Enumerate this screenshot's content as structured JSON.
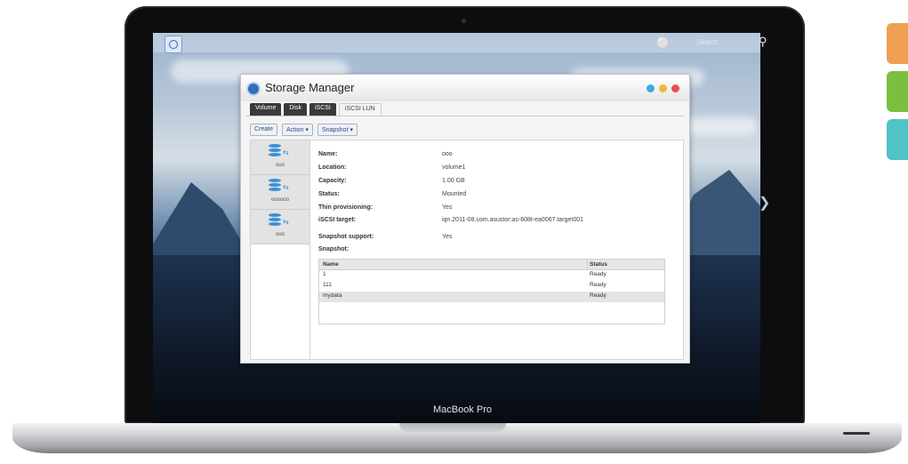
{
  "colors": {
    "accent": "#2f6fb7",
    "tab_orange": "#f0a052",
    "tab_green": "#7bbf3f",
    "tab_teal": "#4fc3c7"
  },
  "laptop": {
    "model_label": "MacBook Pro"
  },
  "desktop": {
    "search_placeholder": "Search",
    "icons": {
      "home": "home-icon",
      "user": "user-icon",
      "search": "search-icon",
      "next": "chevron-right-icon"
    }
  },
  "window": {
    "title": "Storage Manager",
    "controls": [
      "minimize",
      "maximize",
      "close"
    ],
    "tabs": [
      {
        "label": "Volume",
        "active": false
      },
      {
        "label": "Disk",
        "active": false
      },
      {
        "label": "iSCSI",
        "active": false
      },
      {
        "label": "iSCSI LUN",
        "active": true
      }
    ],
    "toolbar": {
      "create": "Create",
      "action": "Action ▾",
      "snapshot": "Snapshot ▾"
    },
    "luns": [
      {
        "label": "ooo"
      },
      {
        "label": "oooooo"
      },
      {
        "label": "ooo"
      }
    ],
    "properties": [
      {
        "key": "Name:",
        "value": "ooo"
      },
      {
        "key": "Location:",
        "value": "volume1"
      },
      {
        "key": "Capacity:",
        "value": "1.00 GB"
      },
      {
        "key": "Status:",
        "value": "Mounted"
      },
      {
        "key": "Thin provisioning:",
        "value": "Yes"
      },
      {
        "key": "iSCSI target:",
        "value": "iqn.2011-08.com.asustor:as-608t-ea0067.target001"
      },
      {
        "key": "Snapshot support:",
        "value": "Yes"
      }
    ],
    "snapshot_label": "Snapshot:",
    "snapshot_table": {
      "headers": [
        "Name",
        "Status"
      ],
      "rows": [
        {
          "name": "1",
          "status": "Ready"
        },
        {
          "name": "111",
          "status": "Ready"
        },
        {
          "name": "mydata",
          "status": "Ready"
        }
      ]
    }
  }
}
